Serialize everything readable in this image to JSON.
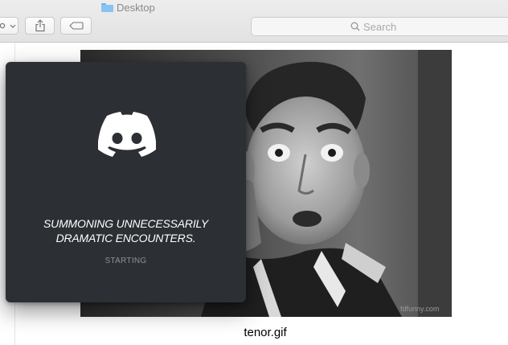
{
  "window": {
    "title": "Desktop",
    "search_placeholder": "Search"
  },
  "toolbar": {
    "view_icon": "gear-dropdown-icon",
    "share_icon": "share-icon",
    "tag_icon": "tag-icon"
  },
  "preview": {
    "filename": "tenor.gif"
  },
  "discord_splash": {
    "icon": "discord-logo-icon",
    "headline_line1": "SUMMONING UNNECESSARILY",
    "headline_line2": "DRAMATIC ENCOUNTERS.",
    "status": "STARTING",
    "background": "#2c2f33"
  }
}
